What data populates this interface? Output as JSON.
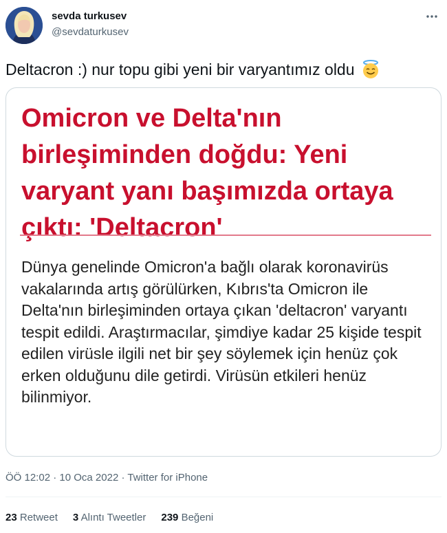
{
  "author": {
    "name": "sevda turkusev",
    "handle": "@sevdaturkusev"
  },
  "tweet": {
    "text": "Deltacron :) nur topu gibi yeni bir varyantımız oldu",
    "emoji": "smiling-face-with-halo-icon"
  },
  "card": {
    "headline": "Omicron ve Delta'nın birleşiminden doğdu: Yeni varyant yanı başımızda ortaya çıktı: 'Deltacron'",
    "body": "Dünya genelinde Omicron'a bağlı olarak koronavirüs vakalarında artış görülürken, Kıbrıs'ta Omicron ile Delta'nın birleşiminden ortaya çıkan 'deltacron' varyantı tespit edildi. Araştırmacılar, şimdiye kadar 25 kişide tespit edilen virüsle ilgili net bir şey söylemek için henüz çok erken olduğunu dile getirdi. Virüsün etkileri henüz bilinmiyor."
  },
  "meta": {
    "time": "ÖÖ 12:02",
    "separator": "·",
    "date": "10 Oca 2022",
    "source": "Twitter for iPhone"
  },
  "stats": {
    "retweets_count": "23",
    "retweets_label": "Retweet",
    "quotes_count": "3",
    "quotes_label": "Alıntı Tweetler",
    "likes_count": "239",
    "likes_label": "Beğeni"
  },
  "colors": {
    "headline": "#c8102e",
    "rule": "#e2798a",
    "secondary_text": "#536471"
  }
}
